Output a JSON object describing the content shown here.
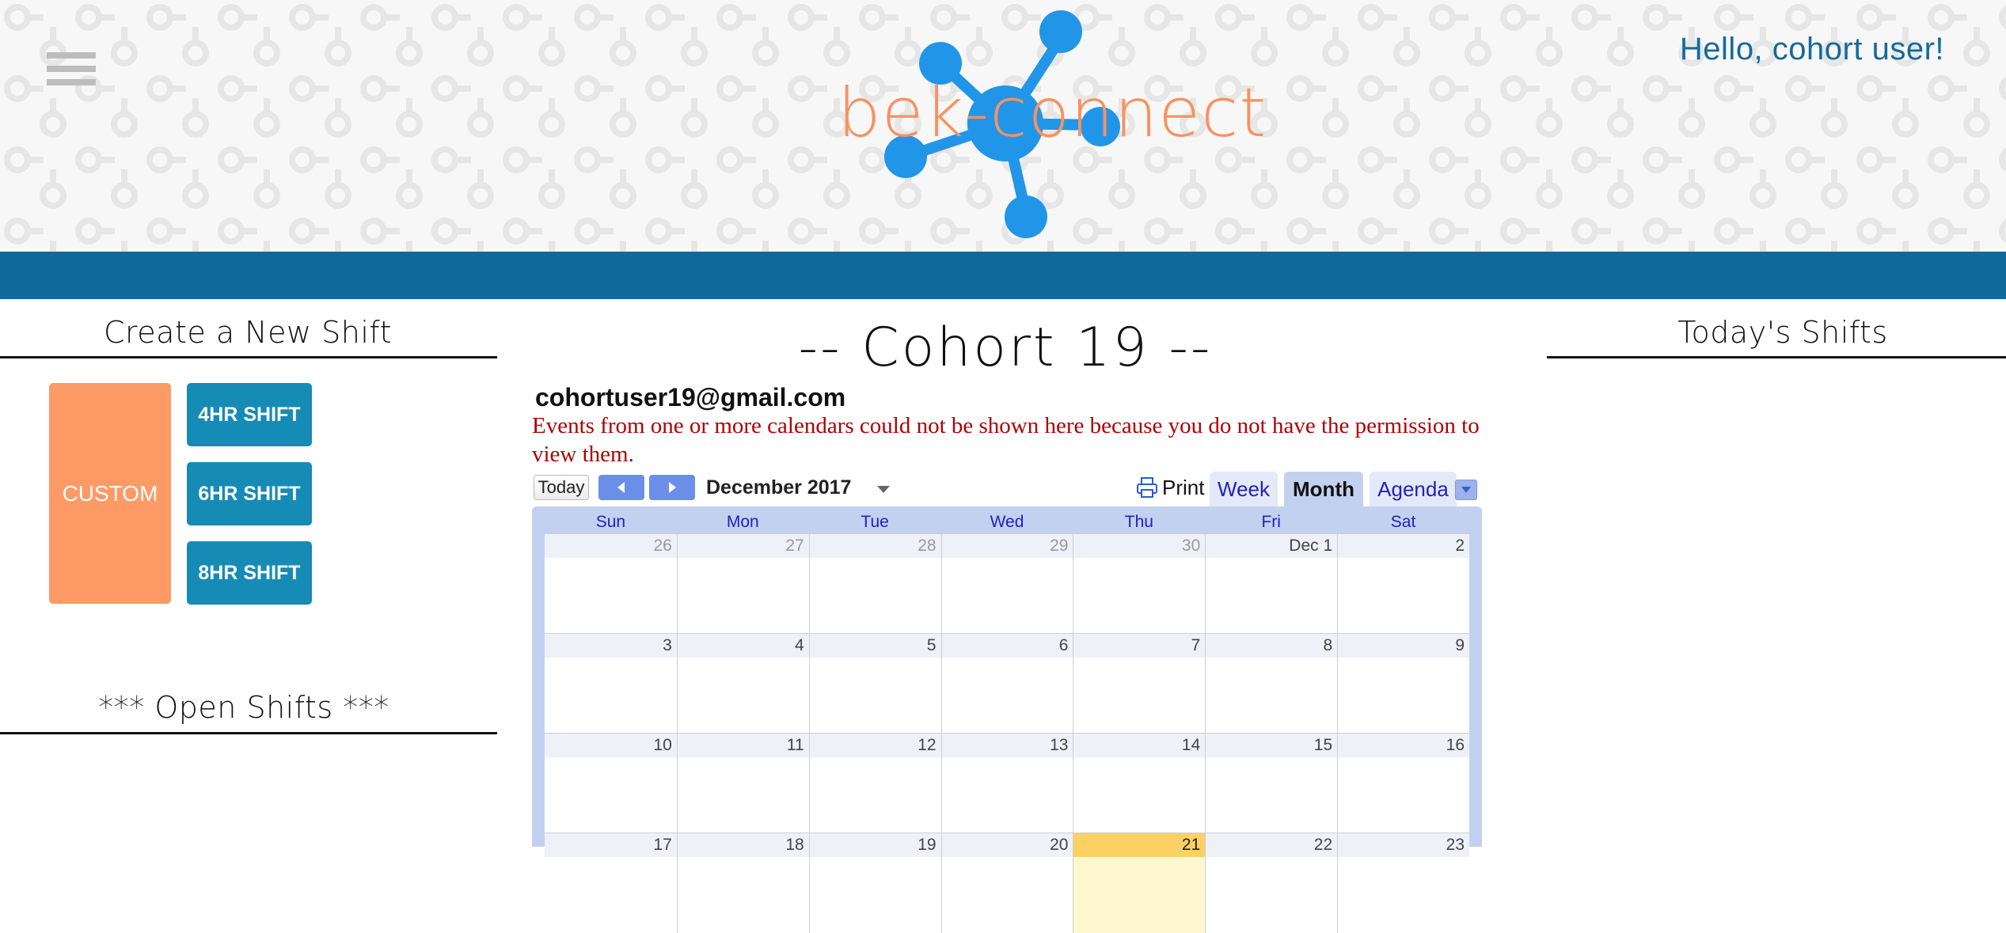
{
  "header": {
    "logo_text": "bek-connect",
    "greeting": "Hello, cohort user!"
  },
  "left": {
    "create_title": "Create a New Shift",
    "custom_label": "CUSTOM",
    "shift_buttons": [
      "4HR SHIFT",
      "6HR SHIFT",
      "8HR SHIFT"
    ],
    "open_title": "*** Open Shifts ***"
  },
  "center": {
    "title": "-- Cohort 19 --",
    "calendar_owner": "cohortuser19@gmail.com",
    "error": "Events from one or more calendars could not be shown here because you do not have the permission to view them."
  },
  "calendar": {
    "today_label": "Today",
    "month_label": "December 2017",
    "print_label": "Print",
    "views": [
      "Week",
      "Month",
      "Agenda"
    ],
    "active_view": "Month",
    "days_of_week": [
      "Sun",
      "Mon",
      "Tue",
      "Wed",
      "Thu",
      "Fri",
      "Sat"
    ],
    "weeks": [
      [
        "26",
        "27",
        "28",
        "29",
        "30",
        "Dec 1",
        "2"
      ],
      [
        "3",
        "4",
        "5",
        "6",
        "7",
        "8",
        "9"
      ],
      [
        "10",
        "11",
        "12",
        "13",
        "14",
        "15",
        "16"
      ],
      [
        "17",
        "18",
        "19",
        "20",
        "21",
        "22",
        "23"
      ]
    ],
    "other_month_cells": [
      "0-0",
      "0-1",
      "0-2",
      "0-3",
      "0-4"
    ],
    "today_cell": "3-4",
    "highlight_color": "#fad163"
  },
  "right": {
    "todays_title": "Today's Shifts"
  },
  "colors": {
    "brand_blue": "#0f6a9b",
    "logo_orange": "#f9915f",
    "custom_button": "#fe9a66",
    "shift_button": "#168bb5"
  },
  "icons": {
    "menu": "hamburger-menu-icon",
    "prev": "chevron-left-icon",
    "next": "chevron-right-icon",
    "print": "printer-icon",
    "dropdown": "triangle-down-icon"
  }
}
